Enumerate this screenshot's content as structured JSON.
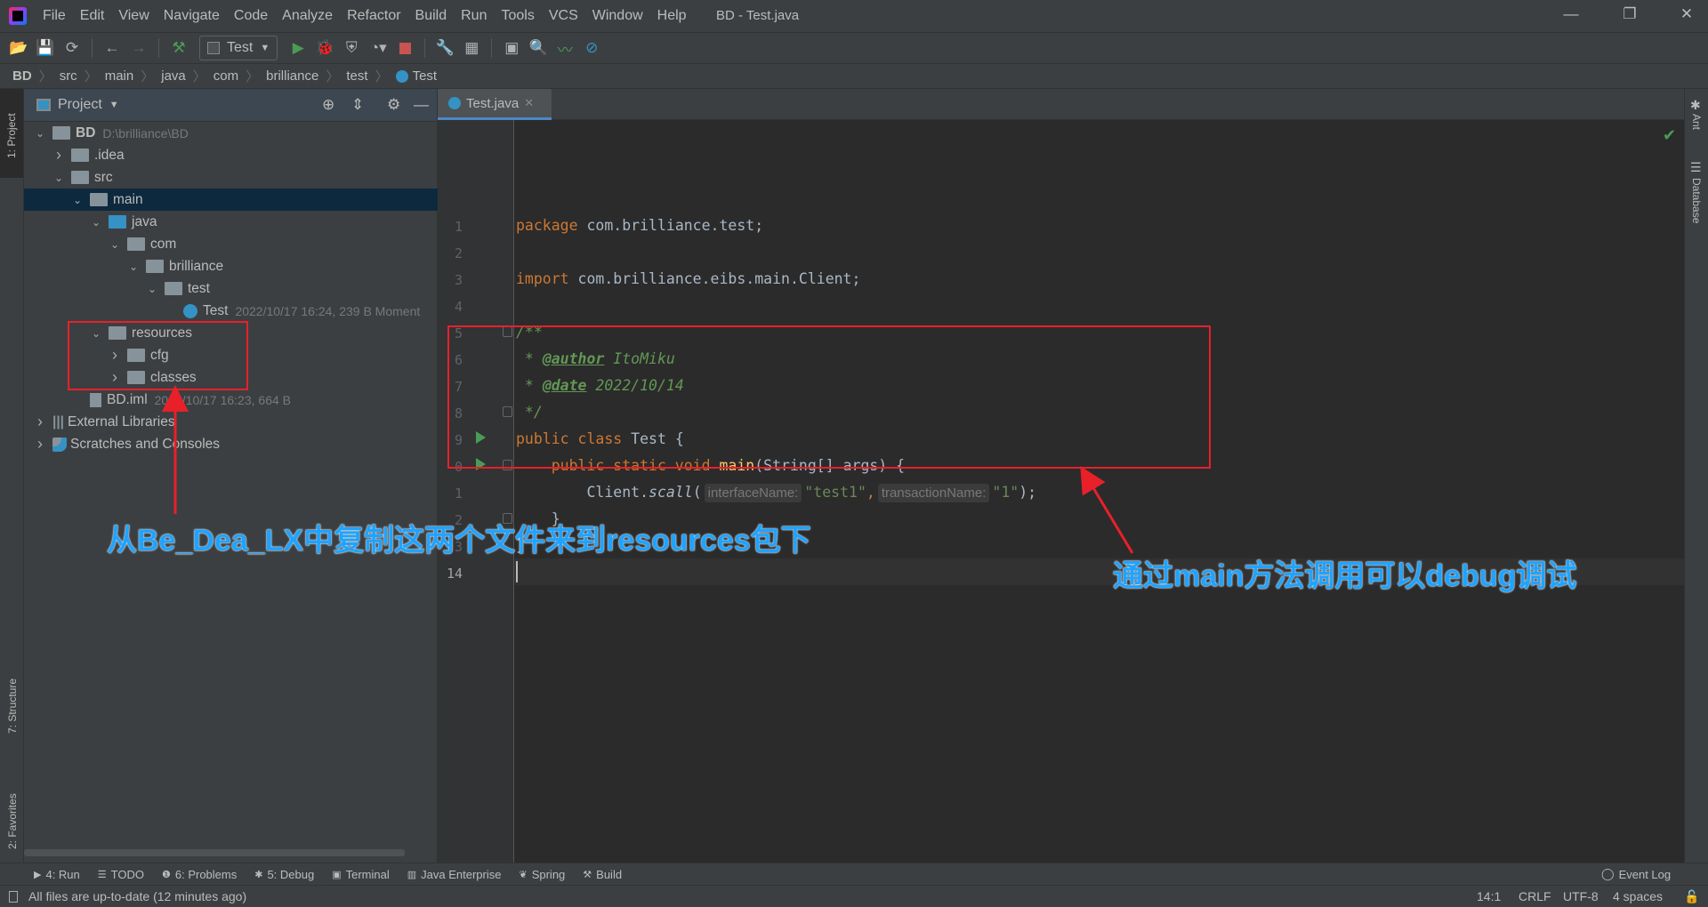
{
  "window": {
    "title": "BD - Test.java",
    "controls": [
      "—",
      "❐",
      "✕"
    ]
  },
  "menu": [
    "File",
    "Edit",
    "View",
    "Navigate",
    "Code",
    "Analyze",
    "Refactor",
    "Build",
    "Run",
    "Tools",
    "VCS",
    "Window",
    "Help"
  ],
  "toolbar": {
    "run_config": "Test"
  },
  "breadcrumbs": [
    "BD",
    "src",
    "main",
    "java",
    "com",
    "brilliance",
    "test",
    "Test"
  ],
  "left_stripe": {
    "project": "1: Project",
    "structure": "7: Structure",
    "favorites": "2: Favorites"
  },
  "right_stripe": {
    "ant": "Ant",
    "database": "Database"
  },
  "project_panel": {
    "title": "Project",
    "tree": [
      {
        "label": "BD",
        "meta": "D:\\brilliance\\BD",
        "depth": 0,
        "expanded": true,
        "icon": "module"
      },
      {
        "label": ".idea",
        "depth": 1,
        "expanded": false,
        "icon": "folder"
      },
      {
        "label": "src",
        "depth": 1,
        "expanded": true,
        "icon": "folder"
      },
      {
        "label": "main",
        "depth": 2,
        "expanded": true,
        "icon": "folder",
        "selected": true
      },
      {
        "label": "java",
        "depth": 3,
        "expanded": true,
        "icon": "source-folder"
      },
      {
        "label": "com",
        "depth": 4,
        "expanded": true,
        "icon": "package"
      },
      {
        "label": "brilliance",
        "depth": 5,
        "expanded": true,
        "icon": "package"
      },
      {
        "label": "test",
        "depth": 6,
        "expanded": true,
        "icon": "package"
      },
      {
        "label": "Test",
        "meta": "2022/10/17 16:24, 239 B Moment",
        "depth": 7,
        "icon": "class"
      },
      {
        "label": "resources",
        "depth": 3,
        "expanded": true,
        "icon": "resources-folder"
      },
      {
        "label": "cfg",
        "depth": 4,
        "expanded": false,
        "icon": "folder"
      },
      {
        "label": "classes",
        "depth": 4,
        "expanded": false,
        "icon": "folder"
      },
      {
        "label": "BD.iml",
        "meta": "2022/10/17 16:23, 664 B",
        "depth": 2,
        "icon": "iml-file"
      },
      {
        "label": "External Libraries",
        "depth": 0,
        "expanded": false,
        "icon": "libraries"
      },
      {
        "label": "Scratches and Consoles",
        "depth": 0,
        "expanded": false,
        "icon": "scratches"
      }
    ]
  },
  "editor": {
    "tab": "Test.java",
    "lines": [
      "1",
      "2",
      "3",
      "4",
      "5",
      "6",
      "7",
      "8",
      "9",
      "0",
      "1",
      "2",
      "3",
      "14"
    ],
    "code": {
      "l1_kw": "package",
      "l1_rest": " com.brilliance.test;",
      "l3_kw": "import",
      "l3_rest": " com.brilliance.eibs.main.Client;",
      "l5": "/**",
      "l6_star": " * ",
      "l6_tag": "@author",
      "l6_val": " ItoMiku",
      "l7_star": " * ",
      "l7_tag": "@date",
      "l7_val": " 2022/10/14",
      "l8": " */",
      "l9_kw": "public class",
      "l9_rest": " Test {",
      "l10_kw": "    public static void ",
      "l10_fn": "main",
      "l10_rest": "(String[] args) {",
      "l11_a": "        Client.",
      "l11_fn": "scall",
      "l11_b": "(",
      "l11_hint1": "interfaceName:",
      "l11_s1": "\"test1\"",
      "l11_c": ",",
      "l11_hint2": "transactionName:",
      "l11_s2": "\"1\"",
      "l11_d": ");",
      "l12": "    }",
      "l13": "}"
    }
  },
  "bottom_tools": [
    {
      "label": "4: Run",
      "icon": "run-icon"
    },
    {
      "label": "TODO",
      "icon": "list-icon"
    },
    {
      "label": "6: Problems",
      "icon": "problems-icon"
    },
    {
      "label": "5: Debug",
      "icon": "debug-icon"
    },
    {
      "label": "Terminal",
      "icon": "terminal-icon"
    },
    {
      "label": "Java Enterprise",
      "icon": "java-enterprise-icon"
    },
    {
      "label": "Spring",
      "icon": "spring-icon"
    },
    {
      "label": "Build",
      "icon": "build-icon"
    }
  ],
  "event_log": "Event Log",
  "status": {
    "message": "All files are up-to-date (12 minutes ago)",
    "position": "14:1",
    "line_sep": "CRLF",
    "encoding": "UTF-8",
    "indent": "4 spaces"
  },
  "annotations": {
    "left": "从Be_Dea_LX中复制这两个文件来到resources包下",
    "right": "通过main方法调用可以debug调试",
    "color": "#1fa3ff",
    "box_color": "#e8202a"
  }
}
